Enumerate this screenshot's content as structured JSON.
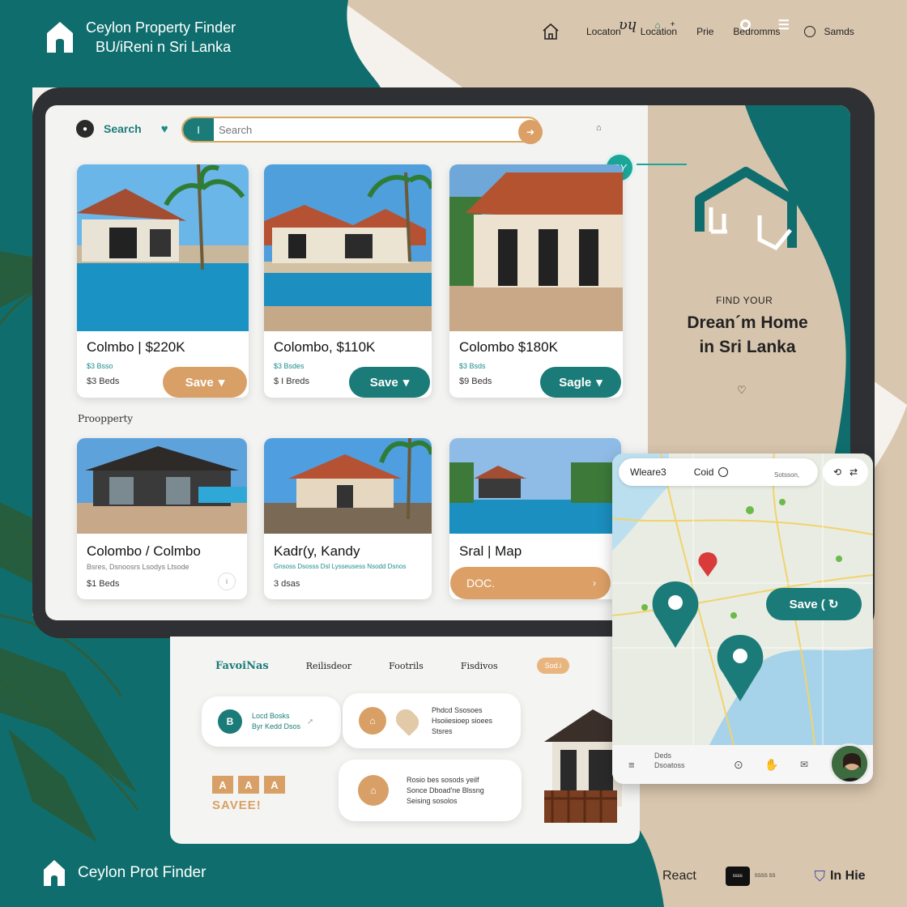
{
  "brand": {
    "line1": "Ceylon Property Finder",
    "line2": "BU/iReni n Sri Lanka"
  },
  "topnav": {
    "items": [
      "Locaton",
      "Location",
      "Prie",
      "Bedromms"
    ],
    "search_label": "Samds"
  },
  "search": {
    "label": "Search",
    "placeholder": "Search",
    "pill": "I"
  },
  "badge": "SY",
  "cards_row1": [
    {
      "title": "Colmbo | $220K",
      "meta1": "$3 Bsso",
      "meta2": "$3 Beds",
      "button": "Save",
      "button_color": "tan"
    },
    {
      "title": "Colombo, $110K",
      "meta1": "$3 Bsdes",
      "meta2": "$ I Breds",
      "button": "Save",
      "button_color": "teal"
    },
    {
      "title": "Colombo $180K",
      "meta1": "$3 Bsds",
      "meta2": "$9 Beds",
      "button": "Sagle",
      "button_color": "teal"
    }
  ],
  "section_label": "Proopperty",
  "cards_row2": [
    {
      "title": "Colombo / Colmbo",
      "meta1": "Bsres, Dsnoosrs Lsodys Ltsode",
      "meta2": "$1 Beds"
    },
    {
      "title": "Kadr(y, Kandy",
      "meta1": "Gnsoss Dsosss Dsl Lysseusess Nsodd Dsnos",
      "meta2": "3 dsas"
    },
    {
      "title": "Sral | Map",
      "meta1": "",
      "meta2": ""
    }
  ],
  "map_button": "DOC.",
  "hero": {
    "small": "FIND YOUR",
    "big_line1": "Drean´m Home",
    "big_line2": "in Sri Lanka"
  },
  "map": {
    "top_left": "Wleare3",
    "top_mid": "Coid",
    "save": "Save (",
    "bottom_text1": "Deds",
    "bottom_text2": "Dsoatoss",
    "area_label": "Sotsson,"
  },
  "lower_tabs": {
    "tabs": [
      "FavoiNas",
      "Reilisdeor",
      "Footrils",
      "Fisdivos"
    ],
    "tag": "Sod.i"
  },
  "info_cards": [
    {
      "badge": "B",
      "line1": "Locd Bosks",
      "line2": "Byr Kedd Dsos"
    },
    {
      "line1": "Phdcd Ssosoes",
      "line2": "Hsoiiesioep sioees",
      "line3": "Stsres"
    },
    {
      "line1": "Rosio bes sosods yeilf",
      "line2": "Sonce Dboad'ne Blssng",
      "line3": "Seising sosolos"
    }
  ],
  "saved_icons": [
    "A",
    "A",
    "A"
  ],
  "saved_label": "SAVEE!",
  "footer": {
    "brand": "Ceylon Prot Finder",
    "react": "React",
    "black_logo": "ssss",
    "small": "SSSS SS",
    "inh": "In Hie"
  }
}
